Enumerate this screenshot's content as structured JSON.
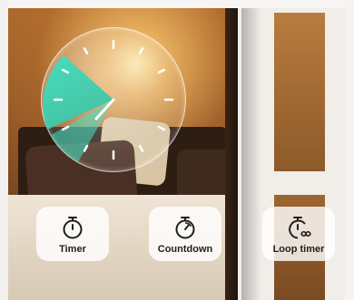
{
  "buttons": [
    {
      "label": "Timer",
      "icon": "timer-icon"
    },
    {
      "label": "Countdown",
      "icon": "countdown-icon"
    },
    {
      "label": "Loop timer",
      "icon": "loop-timer-icon"
    }
  ],
  "colors": {
    "accent": "#3fe3c4",
    "button_bg": "#ffffff",
    "label": "#1f1f1f"
  }
}
